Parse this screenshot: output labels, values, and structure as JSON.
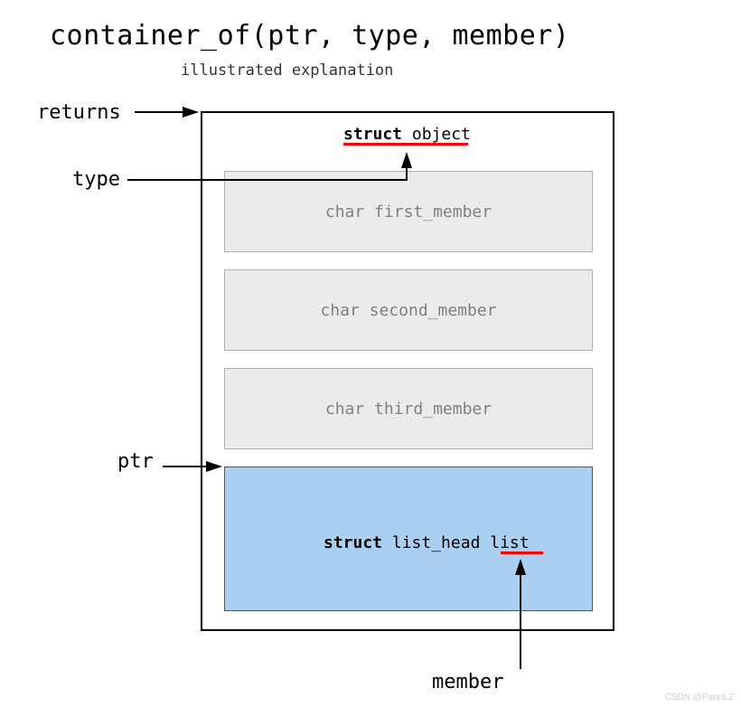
{
  "title": "container_of(ptr, type, member)",
  "subtitle": "illustrated explanation",
  "struct_header_bold": "struct",
  "struct_header_rest": " object",
  "members": {
    "m1": "char first_member",
    "m2": "char second_member",
    "m3": "char third_member"
  },
  "list_member_bold": "struct",
  "list_member_rest": " list_head list",
  "labels": {
    "returns": "returns",
    "type": "type",
    "ptr": "ptr",
    "member": "member"
  },
  "watermark": "CSDN @PannLZ"
}
